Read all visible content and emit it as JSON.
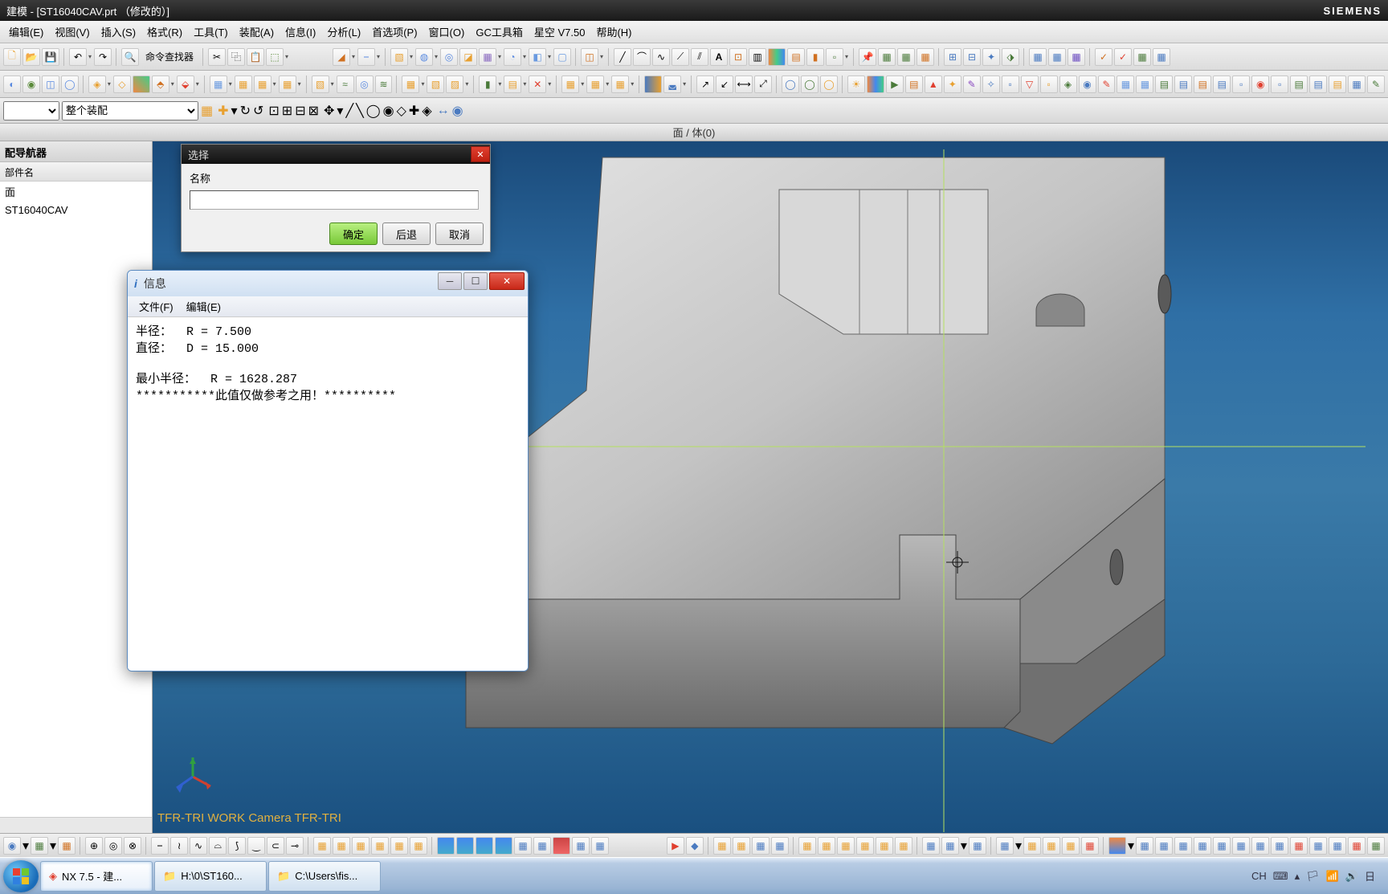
{
  "titlebar": {
    "text": "建模 - [ST16040CAV.prt （修改的）]",
    "brand": "SIEMENS"
  },
  "menu": [
    "编辑(E)",
    "视图(V)",
    "插入(S)",
    "格式(R)",
    "工具(T)",
    "装配(A)",
    "信息(I)",
    "分析(L)",
    "首选项(P)",
    "窗口(O)",
    "GC工具箱",
    "星空 V7.50",
    "帮助(H)"
  ],
  "cmdFinder": "命令查找器",
  "selectionSet": "整个装配",
  "labelRow": "面 / 体(0)",
  "nav": {
    "title": "配导航器",
    "header": "部件名",
    "items": [
      "面",
      "ST16040CAV"
    ]
  },
  "dlgSelect": {
    "title": "选择",
    "nameLabel": "名称",
    "value": "",
    "ok": "确定",
    "back": "后退",
    "cancel": "取消"
  },
  "dlgInfo": {
    "title": "信息",
    "fileMenu": "文件(F)",
    "editMenu": "编辑(E)",
    "body": "半径：  R = 7.500\n直径：  D = 15.000\n\n最小半径：  R = 1628.287\n***********此值仅做参考之用！**********"
  },
  "camera": "TFR-TRI WORK Camera TFR-TRI",
  "taskbar": {
    "t1": "NX 7.5 - 建...",
    "t2": "H:\\0\\ST160...",
    "t3": "C:\\Users\\fis...",
    "ime": "CH",
    "time": "日"
  }
}
